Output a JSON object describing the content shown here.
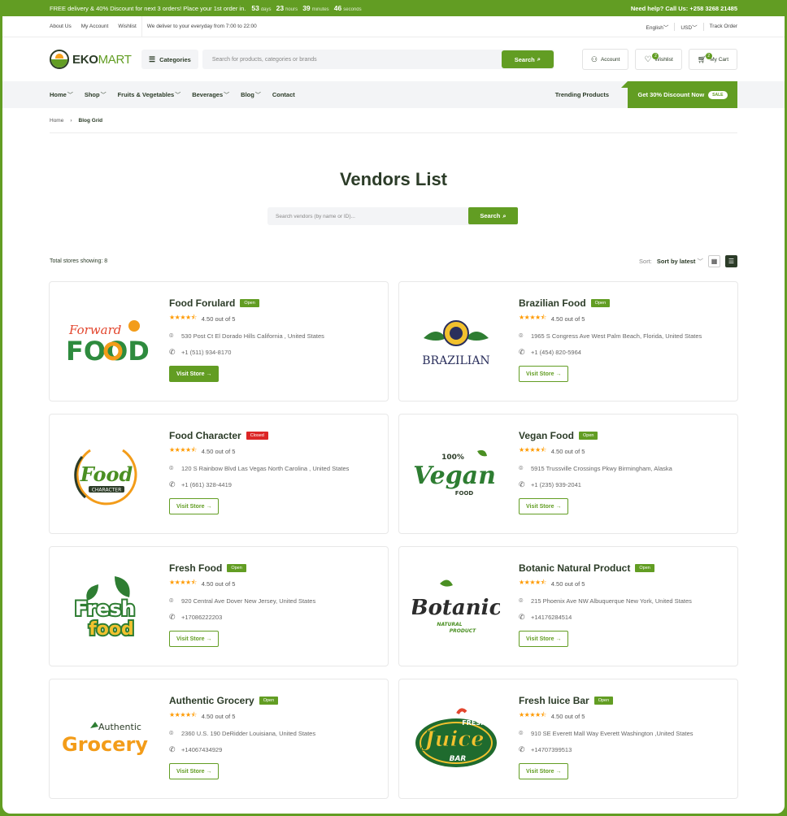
{
  "topbar": {
    "promo": "FREE delivery & 40% Discount for next 3 orders! Place your 1st order in.",
    "days": "53",
    "days_u": "days",
    "hours": "23",
    "hours_u": "hours",
    "minutes": "39",
    "minutes_u": "minutes",
    "seconds": "46",
    "seconds_u": "seconds",
    "help": "Need help? Call Us: +258 3268 21485"
  },
  "util": {
    "about": "About Us",
    "account": "My Account",
    "wishlist": "Wishlist",
    "delivery": "We deliver to your everyday from 7:00 to 22:00",
    "lang": "English",
    "currency": "USD",
    "track": "Track Order"
  },
  "header": {
    "brand_a": "EKO",
    "brand_b": "MART",
    "categories": "Categories",
    "search_placeholder": "Search for products, categories or brands",
    "search_btn": "Search",
    "account": "Account",
    "wishlist": "Wishlist",
    "wishlist_count": "2",
    "cart": "My Cart",
    "cart_count": "2"
  },
  "nav": {
    "items": [
      "Home",
      "Shop",
      "Fruits & Vegetables",
      "Beverages",
      "Blog",
      "Contact"
    ],
    "trending": "Trending Products",
    "promo": "Get 30% Discount Now",
    "sale": "SALE"
  },
  "breadcrumb": {
    "home": "Home",
    "current": "Blog Grid"
  },
  "page": {
    "title": "Vendors List",
    "search_placeholder": "Search vendors (by name or ID)...",
    "search_btn": "Search",
    "total": "Total stores showing: 8",
    "sort_label": "Sort:",
    "sort_value": "Sort by latest"
  },
  "vendors": [
    {
      "name": "Food Forulard",
      "status": "Open",
      "rating": "4.50 out of 5",
      "address": "530 Post Ct El Dorado Hills California , United States",
      "phone": "+1 (511) 934-8170",
      "btn": "Visit Store →",
      "logo": [
        "Forward",
        "FOOD"
      ]
    },
    {
      "name": "Brazilian Food",
      "status": "Open",
      "rating": "4.50 out of 5",
      "address": "1965 S Congress Ave West Palm Beach, Florida, United States",
      "phone": "+1 (454) 820-5964",
      "btn": "Visit Store →",
      "logo": [
        "BRAZILIAN"
      ]
    },
    {
      "name": "Food Character",
      "status": "Closed",
      "rating": "4.50 out of 5",
      "address": "120 S Rainbow Blvd Las Vegas North Carolina , United States",
      "phone": "+1 (661) 328-4419",
      "btn": "Visit Store →",
      "logo": [
        "Food",
        "CHARACTER"
      ]
    },
    {
      "name": "Vegan Food",
      "status": "Open",
      "rating": "4.50 out of 5",
      "address": "5915 Trussville Crossings Pkwy Birmingham, Alaska",
      "phone": "+1 (235) 939-2041",
      "btn": "Visit Store →",
      "logo": [
        "100%",
        "Vegan",
        "FOOD"
      ]
    },
    {
      "name": "Fresh Food",
      "status": "Open",
      "rating": "4.50 out of 5",
      "address": "920 Central Ave Dover New Jersey, United States",
      "phone": "+17086222203",
      "btn": "Visit Store →",
      "logo": [
        "Fresh",
        "food"
      ]
    },
    {
      "name": "Botanic Natural Product",
      "status": "Open",
      "rating": "4.50 out of 5",
      "address": "215 Phoenix Ave NW Albuquerque New York, United States",
      "phone": "+14176284514",
      "btn": "Visit Store →",
      "logo": [
        "Botanic",
        "NATURAL",
        "PRODUCT"
      ]
    },
    {
      "name": "Authentic Grocery",
      "status": "Open",
      "rating": "4.50 out of 5",
      "address": "2360 U.S. 190 DeRidder Louisiana, United States",
      "phone": "+14067434929",
      "btn": "Visit Store →",
      "logo": [
        "Authentic",
        "Grocery"
      ]
    },
    {
      "name": "Fresh luice Bar",
      "status": "Open",
      "rating": "4.50 out of 5",
      "address": "910 SE Everett Mall Way Everett Washington ,United States",
      "phone": "+14707399513",
      "btn": "Visit Store →",
      "logo": [
        "FRESH",
        "Juice",
        "BAR"
      ]
    }
  ],
  "colors": {
    "brand": "#629d23",
    "dark": "#2c3c28",
    "star": "#ff9a00",
    "closed": "#dc2626"
  }
}
